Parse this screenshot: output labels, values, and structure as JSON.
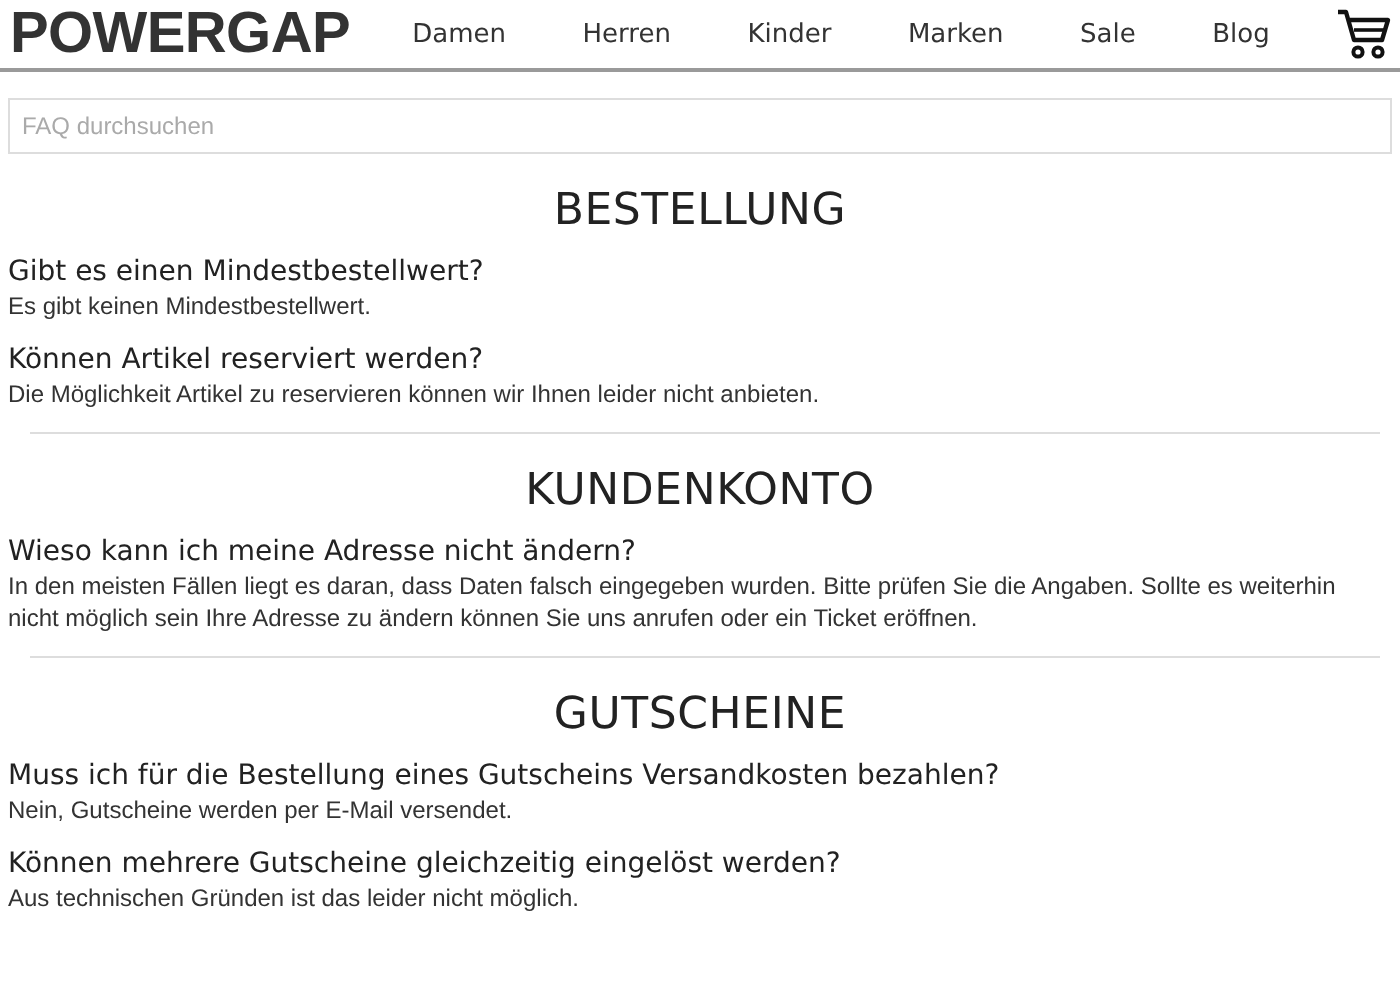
{
  "header": {
    "logo": "POWERGAP",
    "nav": [
      "Damen",
      "Herren",
      "Kinder",
      "Marken",
      "Sale",
      "Blog"
    ]
  },
  "search": {
    "placeholder": "FAQ durchsuchen"
  },
  "sections": [
    {
      "title": "BESTELLUNG",
      "items": [
        {
          "question": "Gibt es einen Mindestbestellwert?",
          "answer": "Es gibt keinen Mindestbestellwert."
        },
        {
          "question": "Können Artikel reserviert werden?",
          "answer": "Die Möglichkeit Artikel zu reservieren können wir Ihnen leider nicht anbieten."
        }
      ]
    },
    {
      "title": "KUNDENKONTO",
      "items": [
        {
          "question": "Wieso kann ich meine Adresse nicht ändern?",
          "answer": "In den meisten Fällen liegt es daran, dass Daten falsch eingegeben wurden. Bitte prüfen Sie die Angaben. Sollte es weiterhin nicht möglich sein Ihre Adresse zu ändern können Sie uns anrufen oder ein Ticket eröffnen."
        }
      ]
    },
    {
      "title": "GUTSCHEINE",
      "items": [
        {
          "question": "Muss ich für die Bestellung eines Gutscheins Versandkosten bezahlen?",
          "answer": "Nein, Gutscheine werden per E-Mail versendet."
        },
        {
          "question": "Können mehrere Gutscheine gleichzeitig eingelöst werden?",
          "answer": "Aus technischen Gründen ist das leider nicht möglich."
        }
      ]
    }
  ]
}
